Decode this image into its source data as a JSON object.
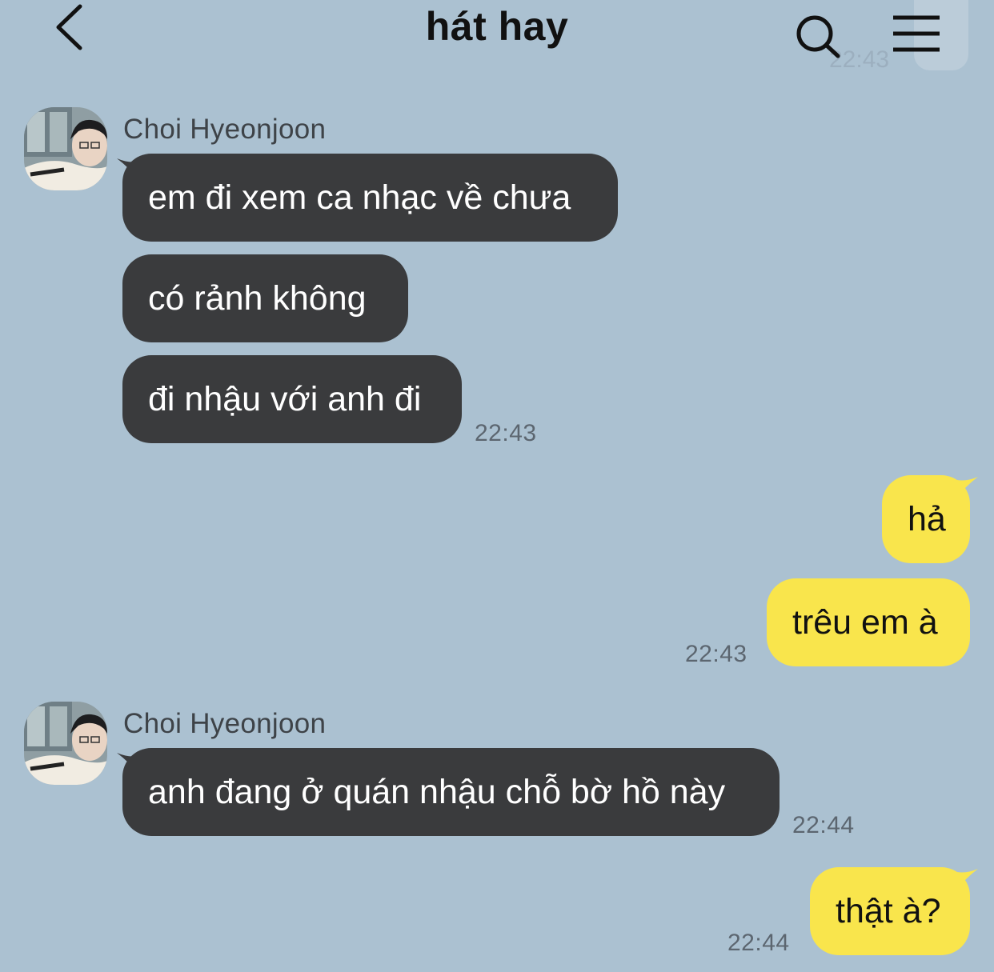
{
  "header": {
    "title": "hát hay",
    "back_icon": "chevron-left-icon",
    "search_icon": "search-icon",
    "menu_icon": "hamburger-menu-icon"
  },
  "ghost_time": "22:43",
  "messages": [
    {
      "sender": "Choi Hyeonjoon",
      "direction": "incoming",
      "texts": [
        "em đi xem ca nhạc về chưa",
        "có rảnh không",
        "đi nhậu với anh đi"
      ],
      "time": "22:43"
    },
    {
      "sender": "me",
      "direction": "outgoing",
      "texts": [
        "hả",
        "trêu em à"
      ],
      "time": "22:43"
    },
    {
      "sender": "Choi Hyeonjoon",
      "direction": "incoming",
      "texts": [
        "anh đang ở quán nhậu chỗ bờ hồ này"
      ],
      "time": "22:44"
    },
    {
      "sender": "me",
      "direction": "outgoing",
      "texts": [
        "thật à?"
      ],
      "time": "22:44"
    }
  ],
  "colors": {
    "background": "#abc1d1",
    "incoming_bubble": "#3a3b3d",
    "outgoing_bubble": "#f9e54c"
  }
}
